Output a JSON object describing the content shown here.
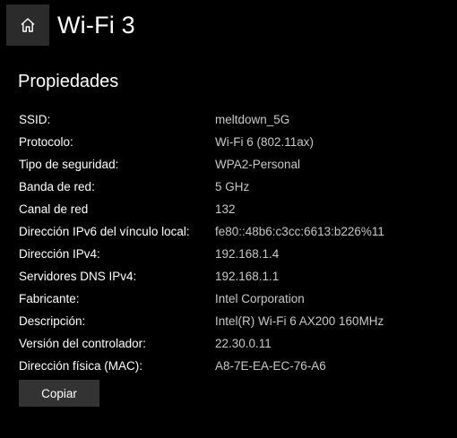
{
  "header": {
    "home_icon": "home-icon",
    "title": "Wi-Fi 3"
  },
  "section": {
    "title": "Propiedades"
  },
  "properties": [
    {
      "label": "SSID:",
      "value": "meltdown_5G"
    },
    {
      "label": "Protocolo:",
      "value": "Wi-Fi 6 (802.11ax)"
    },
    {
      "label": "Tipo de seguridad:",
      "value": "WPA2-Personal"
    },
    {
      "label": "Banda de red:",
      "value": "5 GHz"
    },
    {
      "label": "Canal de red",
      "value": "132"
    },
    {
      "label": "Dirección IPv6 del vínculo local:",
      "value": "fe80::48b6:c3cc:6613:b226%11"
    },
    {
      "label": "Dirección IPv4:",
      "value": "192.168.1.4"
    },
    {
      "label": "Servidores DNS IPv4:",
      "value": "192.168.1.1"
    },
    {
      "label": "Fabricante:",
      "value": "Intel Corporation"
    },
    {
      "label": "Descripción:",
      "value": "Intel(R) Wi-Fi 6 AX200 160MHz"
    },
    {
      "label": "Versión del controlador:",
      "value": "22.30.0.11"
    },
    {
      "label": "Dirección física (MAC):",
      "value": "A8-7E-EA-EC-76-A6"
    }
  ],
  "actions": {
    "copy_label": "Copiar"
  },
  "colors": {
    "background": "#000000",
    "label": "#ffffff",
    "value": "#c8c8c8",
    "button": "#333333"
  }
}
